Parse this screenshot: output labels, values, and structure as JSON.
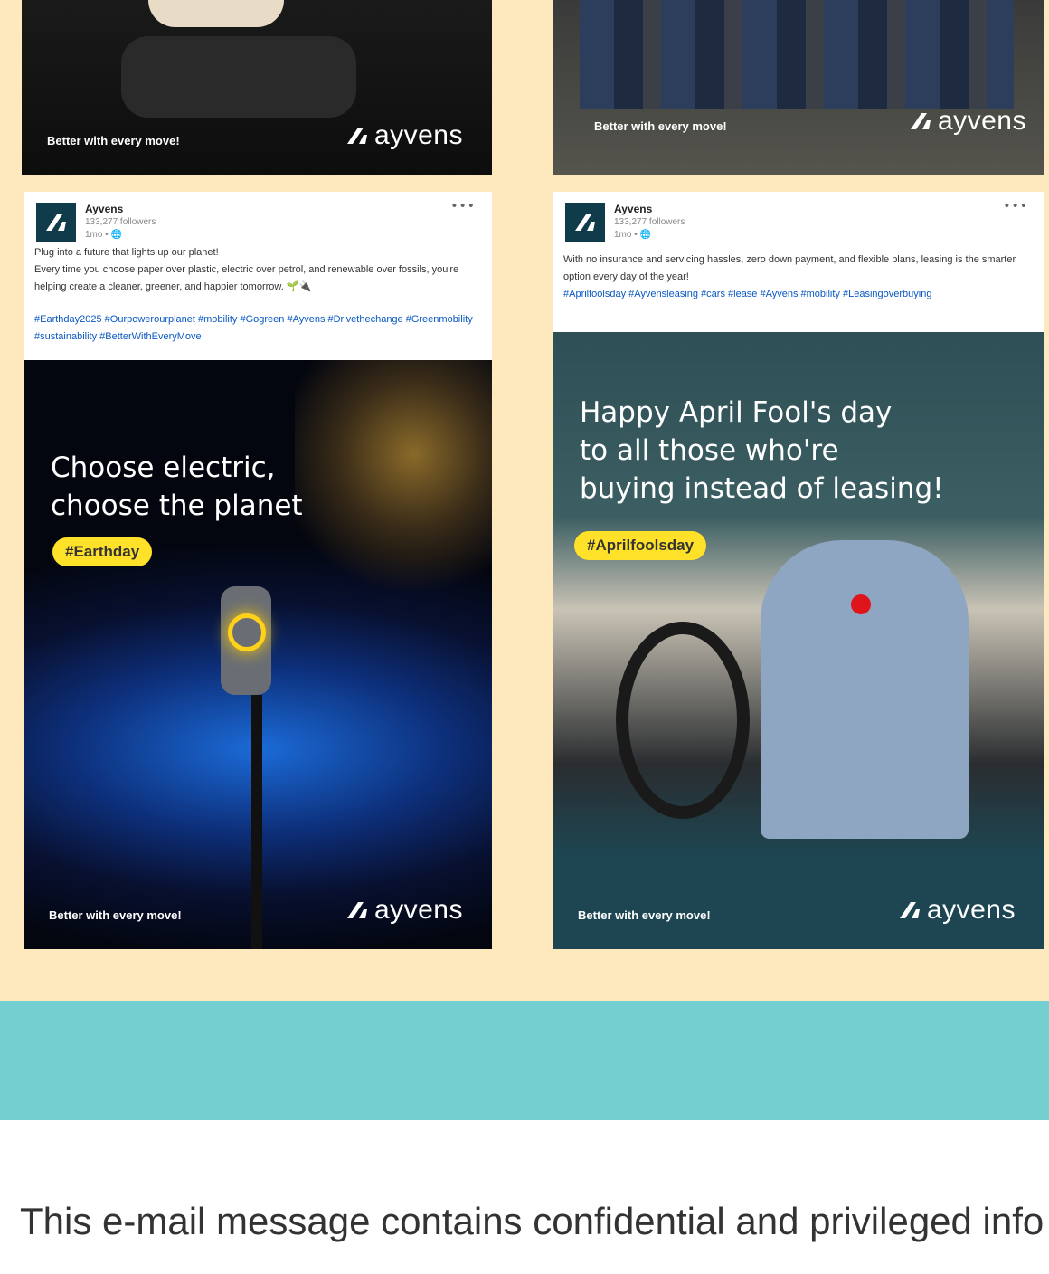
{
  "colors": {
    "top_band": "#fde9bd",
    "teal_band": "#74d0d0",
    "brand_teal": "#1c4a57",
    "hashtag_yellow": "#ffe12a",
    "link_blue": "#0b59c2"
  },
  "brand": {
    "tagline": "Better with every move!",
    "logo_text": "ayvens",
    "logo_icon": "ayvens-logo-icon"
  },
  "posts": [
    {
      "author": "Ayvens",
      "followers": "133,277 followers",
      "time": "1mo • 🌐",
      "body_1": "Plug into a future that lights up our planet!",
      "body_2": "Every time you choose paper over plastic, electric over petrol, and renewable over fossils, you're helping create a cleaner, greener, and happier tomorrow. 🌱🔌",
      "tags": "#Earthday2025 #Ourpowerourplanet #mobility #Gogreen #Ayvens #Drivethechange #Greenmobility #sustainability #BetterWithEveryMove",
      "headline_1": "Choose electric,",
      "headline_2": "choose the planet",
      "hashtag": "#Earthday"
    },
    {
      "author": "Ayvens",
      "followers": "133,277 followers",
      "time": "1mo • 🌐",
      "body_1": "With no insurance and servicing hassles, zero down payment, and flexible plans, leasing is the smarter option every day of the year!",
      "tags": "#Aprilfoolsday #Ayvensleasing #cars #lease #Ayvens #mobility #Leasingoverbuying",
      "headline_1": "Happy April Fool's day",
      "headline_2": "to all those who're",
      "headline_3": "buying instead of leasing!",
      "hashtag": "#Aprilfoolsday"
    }
  ],
  "disclaimer": "This e-mail message contains confidential and privileged info"
}
